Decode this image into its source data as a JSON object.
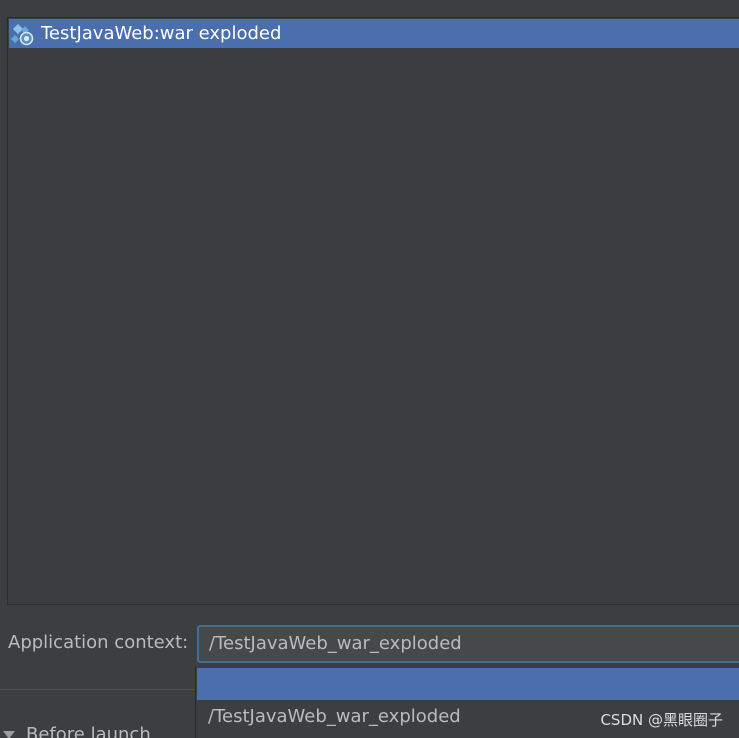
{
  "artifact_list": {
    "items": [
      {
        "label": "TestJavaWeb:war exploded",
        "icon": "web-artifact-icon",
        "selected": true
      }
    ]
  },
  "application_context": {
    "label": "Application context:",
    "value": "/TestJavaWeb_war_exploded",
    "dropdown_options": [
      "",
      "/TestJavaWeb_war_exploded"
    ],
    "highlighted_option_index": 0
  },
  "before_launch": {
    "label": "Before launch"
  },
  "watermark": {
    "text": "CSDN @黑眼圈子"
  },
  "colors": {
    "selection": "#4b6eaf",
    "background": "#3c3f41",
    "focus_border": "#466d94"
  }
}
